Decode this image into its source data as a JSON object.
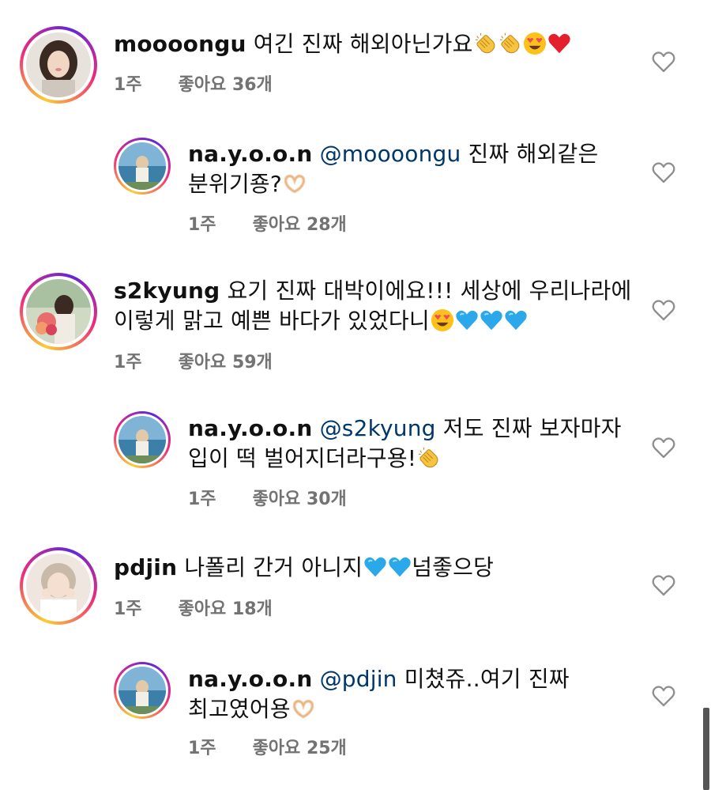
{
  "comments": [
    {
      "username": "moooongu",
      "text_line1": " 여긴 진짜 해외아닌가요",
      "text_line2": "",
      "mention": "",
      "emojis": [
        "clap-emoji",
        "clap-emoji",
        "heart-eyes-emoji",
        "red-heart-emoji"
      ],
      "time": "1주",
      "likes": "좋아요 36개",
      "reply": false
    },
    {
      "username": "na.y.o.o.n",
      "mention": "@moooongu",
      "text_line1": " 진짜 해외같은",
      "text_line2": "분위기죵?",
      "emojis_line2": [
        "heart-hands-emoji"
      ],
      "time": "1주",
      "likes": "좋아요 28개",
      "reply": true
    },
    {
      "username": "s2kyung",
      "text_line1": " 요기 진짜 대박이에요!!! 세상에 우리나라에",
      "text_line2": "이렇게 맑고 예쁜 바다가 있었다니",
      "emojis_line2": [
        "heart-eyes-emoji",
        "blue-heart-emoji",
        "blue-heart-emoji",
        "blue-heart-emoji"
      ],
      "time": "1주",
      "likes": "좋아요 59개",
      "reply": false
    },
    {
      "username": "na.y.o.o.n",
      "mention": "@s2kyung",
      "text_line1": " 저도 진짜 보자마자",
      "text_line2": "입이 떡 벌어지더라구용!",
      "emojis_line2": [
        "clap-emoji"
      ],
      "time": "1주",
      "likes": "좋아요 30개",
      "reply": true
    },
    {
      "username": "pdjin",
      "text_line1": " 나폴리 간거 아니지",
      "text_after_emoji": "넘좋으당",
      "emojis": [
        "blue-heart-emoji",
        "blue-heart-emoji"
      ],
      "time": "1주",
      "likes": "좋아요 18개",
      "reply": false
    },
    {
      "username": "na.y.o.o.n",
      "mention": "@pdjin",
      "text_line1": " 미쳤쥬..여기 진짜",
      "text_line2": "최고였어용",
      "emojis_line2": [
        "heart-hands-emoji"
      ],
      "time": "1주",
      "likes": "좋아요 25개",
      "reply": true
    }
  ],
  "icons": {
    "like": "heart-outline-icon"
  },
  "colors": {
    "mention": "#00376b",
    "meta": "#737373",
    "ring_start": "#f9ce34",
    "ring_mid": "#ee2a7b",
    "ring_end": "#6228d7"
  }
}
